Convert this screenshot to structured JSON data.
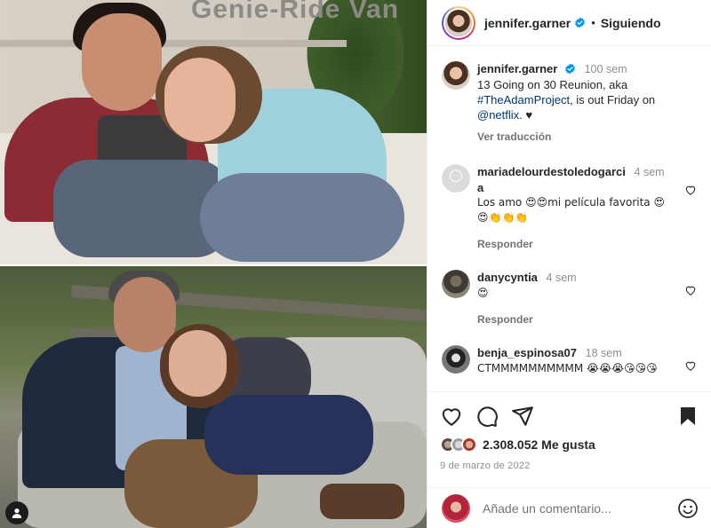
{
  "media": {
    "truck_text": "Genie-Ride Van"
  },
  "header": {
    "username": "jennifer.garner",
    "separator": "•",
    "follow_status": "Siguiendo"
  },
  "caption": {
    "username": "jennifer.garner",
    "time": "100 sem",
    "text_1": "13 Going on 30 Reunion, aka",
    "hashtag": "#TheAdamProject",
    "text_2": ", is out Friday on",
    "mention": "@netflix",
    "text_3": ". ♥",
    "translate": "Ver traducción"
  },
  "comments": [
    {
      "username_line1": "mariadelourdestoledogarci",
      "username_line2": "a",
      "time": "4 sem",
      "text": "Los amo 😍😍mi película favorita 😍😍👏👏👏",
      "reply": "Responder"
    },
    {
      "username": "danycyntia",
      "time": "4 sem",
      "text": "😍",
      "reply": "Responder"
    },
    {
      "username": "benja_espinosa07",
      "time": "18 sem",
      "text": "CTMMMMMMMMMM 😭😭😭😘😘😘"
    }
  ],
  "actions": {
    "likes": "2.308.052 Me gusta",
    "date": "9 de marzo de 2022"
  },
  "add_comment": {
    "placeholder": "Añade un comentario..."
  },
  "colors": {
    "verified": "#0095f6",
    "text": "#262626",
    "secondary": "#8e8e8e",
    "link": "#00376b"
  }
}
